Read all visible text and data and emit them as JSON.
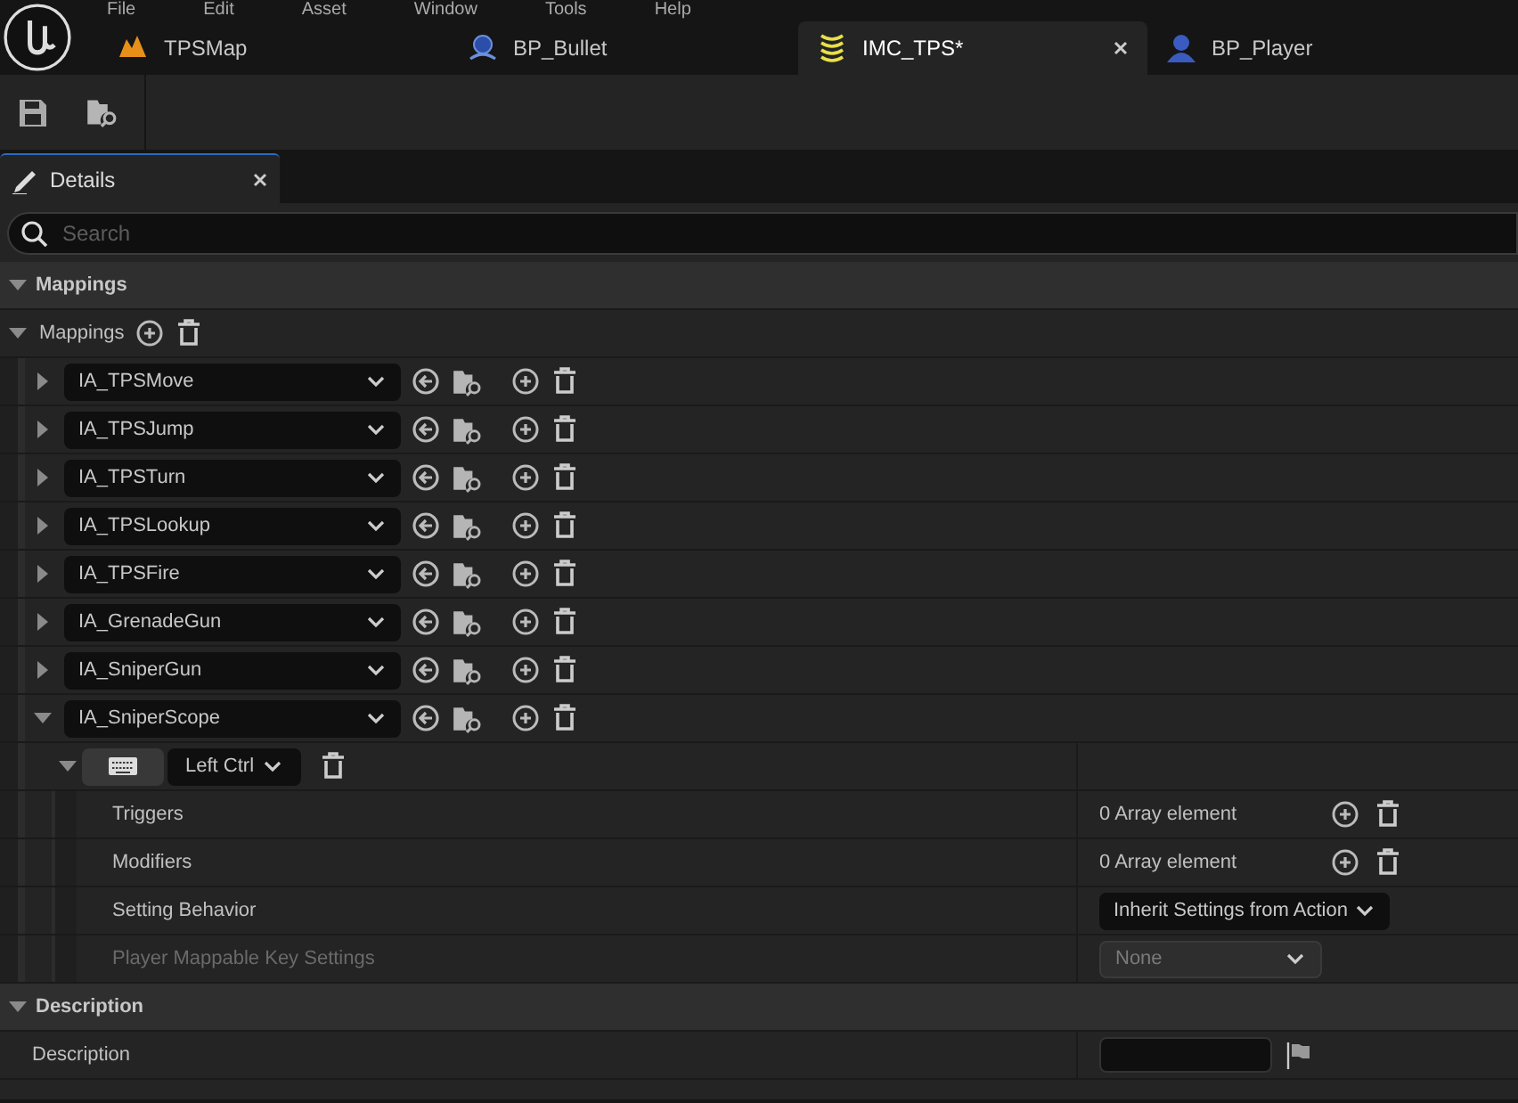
{
  "menu": [
    "File",
    "Edit",
    "Asset",
    "Window",
    "Tools",
    "Help"
  ],
  "document_tabs": [
    {
      "label": "TPSMap",
      "kind": "map",
      "selected": false
    },
    {
      "label": "BP_Bullet",
      "kind": "blueprint",
      "selected": false
    },
    {
      "label": "IMC_TPS*",
      "kind": "input",
      "selected": true
    },
    {
      "label": "BP_Player",
      "kind": "character",
      "selected": false
    }
  ],
  "panel_tab": {
    "label": "Details",
    "selected": true
  },
  "search": {
    "placeholder": "Search"
  },
  "mappings_section": {
    "title": "Mappings",
    "expanded": true,
    "array": {
      "label": "Mappings",
      "expanded": true,
      "items": [
        {
          "action": "IA_TPSMove",
          "expanded": false
        },
        {
          "action": "IA_TPSJump",
          "expanded": false
        },
        {
          "action": "IA_TPSTurn",
          "expanded": false
        },
        {
          "action": "IA_TPSLookup",
          "expanded": false
        },
        {
          "action": "IA_TPSFire",
          "expanded": false
        },
        {
          "action": "IA_GrenadeGun",
          "expanded": false
        },
        {
          "action": "IA_SniperGun",
          "expanded": false
        },
        {
          "action": "IA_SniperScope",
          "expanded": true,
          "key": {
            "label": "Left Ctrl",
            "expanded": true,
            "properties": [
              {
                "label": "Triggers",
                "kind": "array",
                "value": "0 Array element",
                "disabled": false
              },
              {
                "label": "Modifiers",
                "kind": "array",
                "value": "0 Array element",
                "disabled": false
              },
              {
                "label": "Setting Behavior",
                "kind": "dropdown",
                "value": "Inherit Settings from Action",
                "disabled": false
              },
              {
                "label": "Player Mappable Key Settings",
                "kind": "dropdown",
                "value": "None",
                "disabled": true
              }
            ]
          }
        }
      ]
    }
  },
  "description_section": {
    "title": "Description",
    "expanded": true,
    "property": {
      "label": "Description"
    }
  }
}
